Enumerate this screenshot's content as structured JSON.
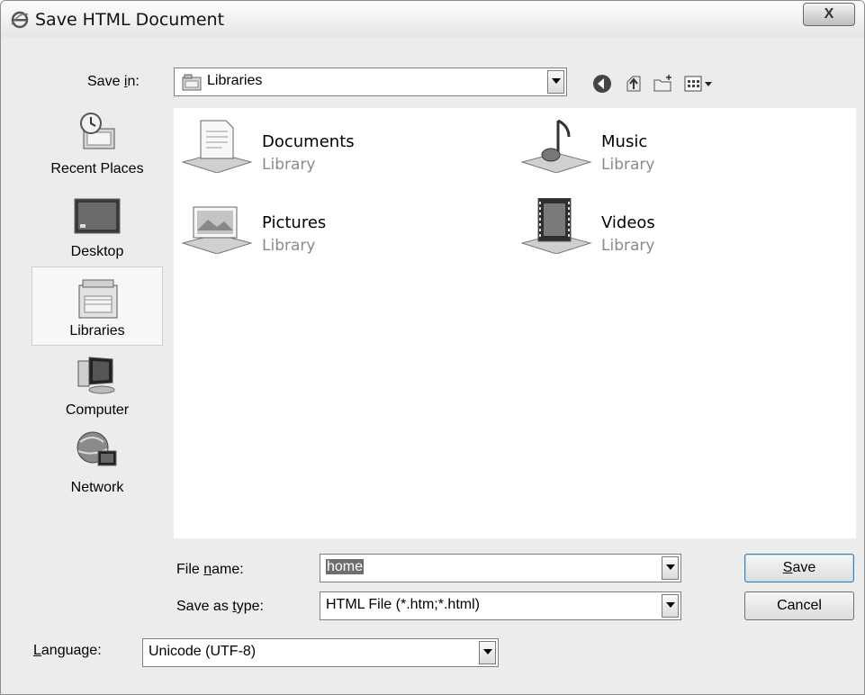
{
  "window": {
    "title": "Save HTML Document",
    "close_label": "X"
  },
  "save_in": {
    "label_pre": "Save ",
    "label_key": "i",
    "label_post": "n:",
    "value": "Libraries"
  },
  "toolbar": {
    "icons": [
      "back-icon",
      "up-folder-icon",
      "new-folder-icon",
      "view-menu-icon"
    ]
  },
  "places": [
    {
      "label": "Recent Places",
      "icon": "recent-places-icon"
    },
    {
      "label": "Desktop",
      "icon": "desktop-icon"
    },
    {
      "label": "Libraries",
      "icon": "libraries-icon",
      "selected": true
    },
    {
      "label": "Computer",
      "icon": "computer-icon"
    },
    {
      "label": "Network",
      "icon": "network-icon"
    }
  ],
  "libraries": [
    {
      "name": "Documents",
      "type": "Library",
      "icon": "documents-library-icon"
    },
    {
      "name": "Music",
      "type": "Library",
      "icon": "music-library-icon"
    },
    {
      "name": "Pictures",
      "type": "Library",
      "icon": "pictures-library-icon"
    },
    {
      "name": "Videos",
      "type": "Library",
      "icon": "videos-library-icon"
    }
  ],
  "file_name": {
    "label_pre": "File ",
    "label_key": "n",
    "label_post": "ame:",
    "value": "home"
  },
  "save_as_type": {
    "label_pre": "Save as ",
    "label_key": "t",
    "label_post": "ype:",
    "value": "HTML File (*.htm;*.html)"
  },
  "language": {
    "label_key": "L",
    "label_post": "anguage:",
    "value": "Unicode (UTF-8)"
  },
  "buttons": {
    "save_key": "S",
    "save_rest": "ave",
    "cancel": "Cancel"
  }
}
